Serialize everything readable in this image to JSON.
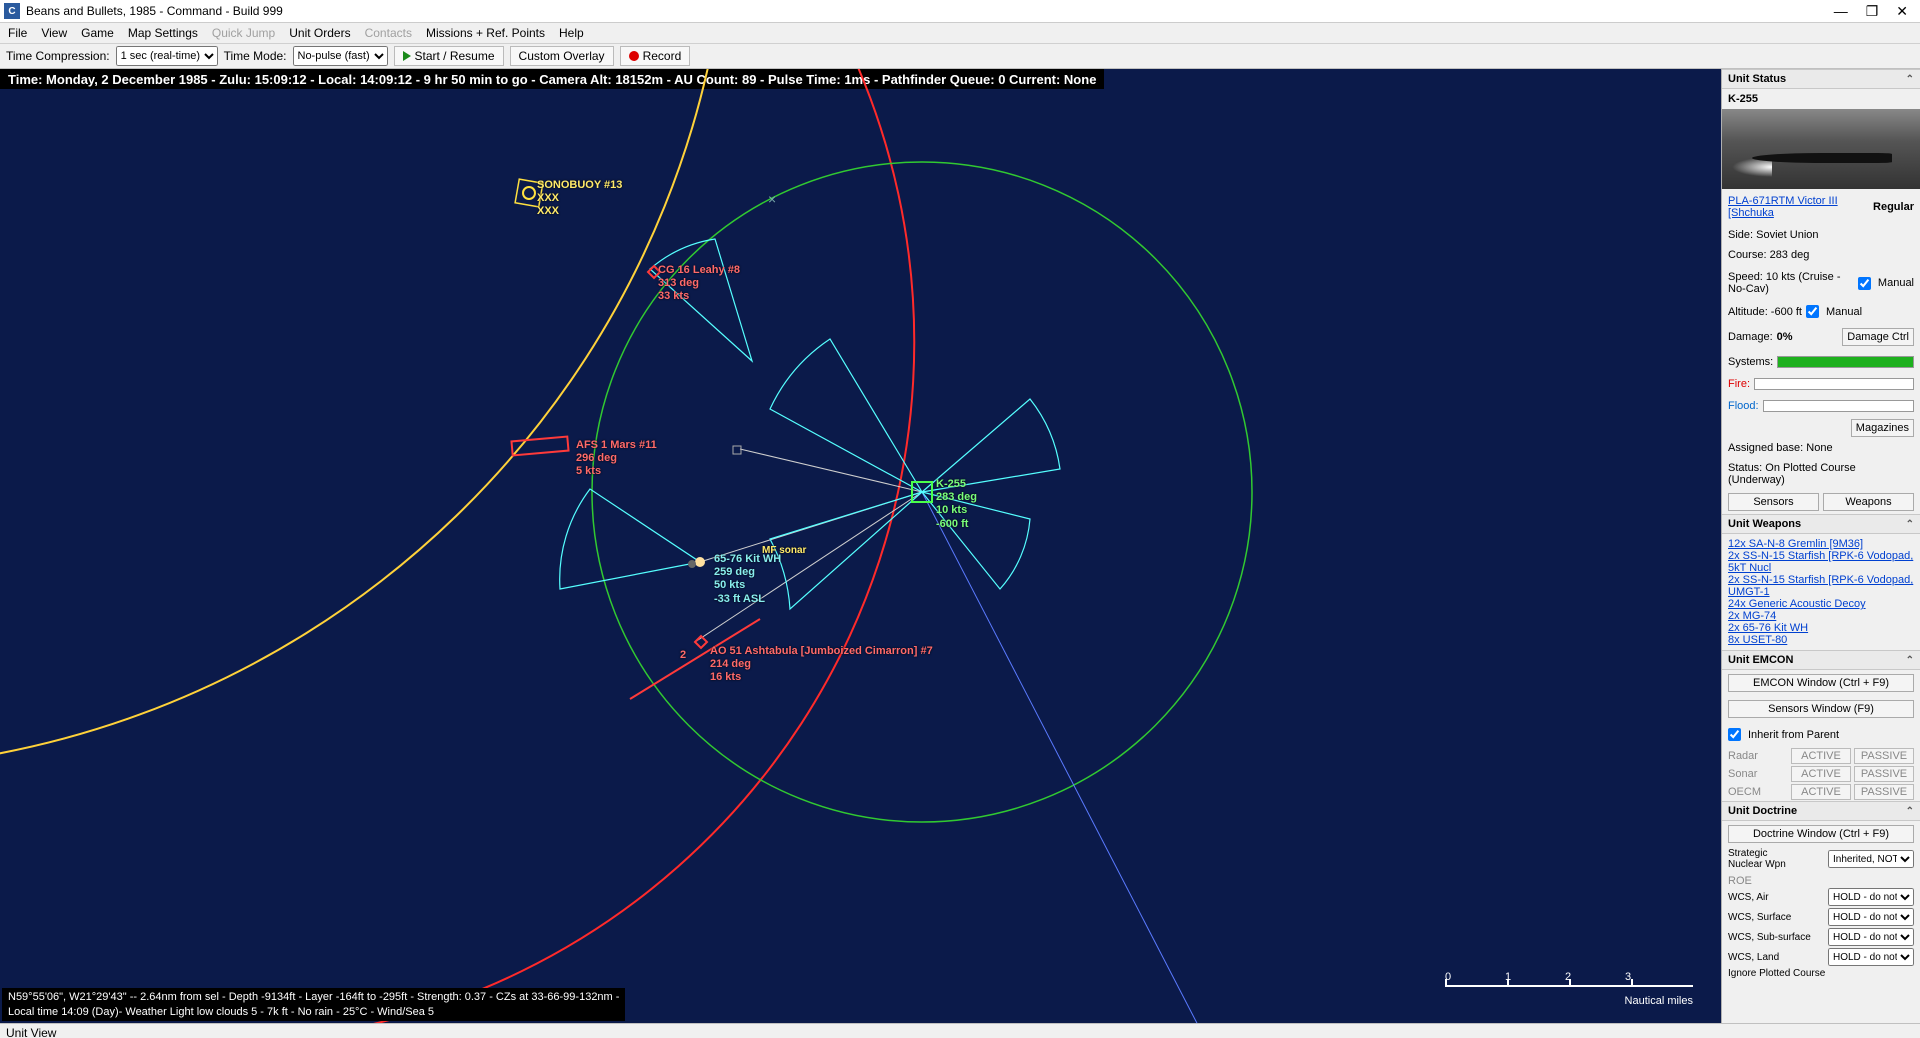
{
  "title": "Beans and Bullets, 1985 - Command - Build 999",
  "menu": [
    "File",
    "View",
    "Game",
    "Map Settings",
    "Quick Jump",
    "Unit Orders",
    "Contacts",
    "Missions + Ref. Points",
    "Help"
  ],
  "menu_dim": [
    4,
    6
  ],
  "toolbar": {
    "tc_label": "Time Compression:",
    "tc_value": "1 sec (real-time)",
    "tm_label": "Time Mode:",
    "tm_value": "No-pulse (fast)",
    "start": "Start / Resume",
    "overlay": "Custom Overlay",
    "record": "Record"
  },
  "info_bar": "Time: Monday, 2 December 1985 - Zulu: 15:09:12 - Local: 14:09:12 - 9 hr 50 min to go -  Camera Alt: 18152m - AU Count: 89 - Pulse Time: 1ms - Pathfinder Queue: 0 Current: None",
  "map_status": {
    "l1": "N59°55'06\", W21°29'43\" -- 2.64nm from sel - Depth -9134ft - Layer -164ft to -295ft - Strength: 0.37 - CZs at 33-66-99-132nm -",
    "l2": "Local time 14:09 (Day)- Weather Light low clouds 5 - 7k ft - No rain - 25°C - Wind/Sea 5"
  },
  "scale": {
    "ticks": [
      "0",
      "1",
      "2",
      "3"
    ],
    "label": "Nautical miles"
  },
  "status_unit_view": "Unit View",
  "units": {
    "sonobuoy": {
      "name": "SONOBUOY #13",
      "l2": "XXX",
      "l3": "XXX"
    },
    "leahy": {
      "name": "CG 16 Leahy #8",
      "course": "313 deg",
      "speed": "33 kts"
    },
    "mars": {
      "name": "AFS 1 Mars #11",
      "course": "296 deg",
      "speed": "5 kts"
    },
    "k255": {
      "name": "K-255",
      "course": "283 deg",
      "speed": "10 kts",
      "depth": "-600 ft"
    },
    "kit": {
      "name": "65-76 Kit WH",
      "course": "259 deg",
      "speed": "50 kts",
      "alt": "-33 ft ASL"
    },
    "mfsonar": "MF sonar",
    "ashtabula": {
      "name": "AO 51 Ashtabula [Jumboized Cimarron] #7",
      "course": "214 deg",
      "speed": "16 kts",
      "badge": "2"
    }
  },
  "panel": {
    "unit_status": "Unit Status",
    "unit_name": "K-255",
    "class_link": "PLA-671RTM Victor III [Shchuka",
    "prof": "Regular",
    "side": "Side: Soviet Union",
    "course": "Course: 283 deg",
    "speed": "Speed: 10 kts (Cruise - No-Cav)",
    "alt": "Altitude: -600 ft",
    "manual": "Manual",
    "damage_lbl": "Damage:",
    "damage_val": "0%",
    "damage_btn": "Damage Ctrl",
    "systems": "Systems:",
    "fire": "Fire:",
    "flood": "Flood:",
    "magazines": "Magazines",
    "base": "Assigned base: None",
    "status": "Status: On Plotted Course (Underway)",
    "sensors_btn": "Sensors",
    "weapons_btn": "Weapons",
    "unit_weapons": "Unit Weapons",
    "weapons": [
      "12x SA-N-8 Gremlin [9M36]",
      "2x SS-N-15 Starfish [RPK-6 Vodopad, 5kT Nucl",
      "2x SS-N-15 Starfish [RPK-6 Vodopad, UMGT-1",
      "24x Generic Acoustic Decoy",
      "2x MG-74",
      "2x 65-76 Kit WH",
      "8x USET-80"
    ],
    "unit_emcon": "Unit EMCON",
    "emcon_btn": "EMCON Window (Ctrl + F9)",
    "sensors_win": "Sensors Window (F9)",
    "inherit": "Inherit from Parent",
    "em_rows": [
      "Radar",
      "Sonar",
      "OECM"
    ],
    "active": "ACTIVE",
    "passive": "PASSIVE",
    "unit_doctrine": "Unit Doctrine",
    "doctrine_btn": "Doctrine Window (Ctrl + F9)",
    "strategic": "Strategic\nNuclear Wpn",
    "inherited": "Inherited, NOT GR",
    "roe": "ROE",
    "wcs_rows": [
      "WCS, Air",
      "WCS, Surface",
      "WCS, Sub-surface",
      "WCS, Land"
    ],
    "hold": "HOLD - do not fire",
    "ignore": "Ignore Plotted Course"
  }
}
